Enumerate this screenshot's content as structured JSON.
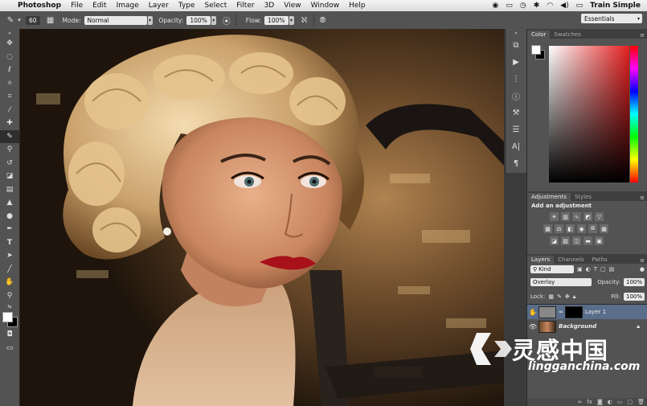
{
  "menubar": {
    "app": "Photoshop",
    "items": [
      "File",
      "Edit",
      "Image",
      "Layer",
      "Type",
      "Select",
      "Filter",
      "3D",
      "View",
      "Window",
      "Help"
    ],
    "user": "Train Simple"
  },
  "options": {
    "brush_size": "60",
    "mode_label": "Mode:",
    "mode_value": "Normal",
    "opacity_label": "Opacity:",
    "opacity_value": "100%",
    "flow_label": "Flow:",
    "flow_value": "100%",
    "workspace": "Essentials"
  },
  "color_panel": {
    "tabs": [
      "Color",
      "Swatches"
    ],
    "fg": "#ffffff",
    "bg": "#000000"
  },
  "adjustments_panel": {
    "tabs": [
      "Adjustments",
      "Styles"
    ],
    "title": "Add an adjustment"
  },
  "layers_panel": {
    "tabs": [
      "Layers",
      "Channels",
      "Paths"
    ],
    "kind": "Kind",
    "blend_mode": "Overlay",
    "opacity_label": "Opacity:",
    "opacity_value": "100%",
    "lock_label": "Lock:",
    "fill_label": "Fill:",
    "fill_value": "100%",
    "layers": [
      {
        "name": "Layer 1",
        "selected": true
      },
      {
        "name": "Background",
        "selected": false
      }
    ]
  },
  "watermark": {
    "cn": "灵感中国",
    "url": "lingganchina.com"
  }
}
